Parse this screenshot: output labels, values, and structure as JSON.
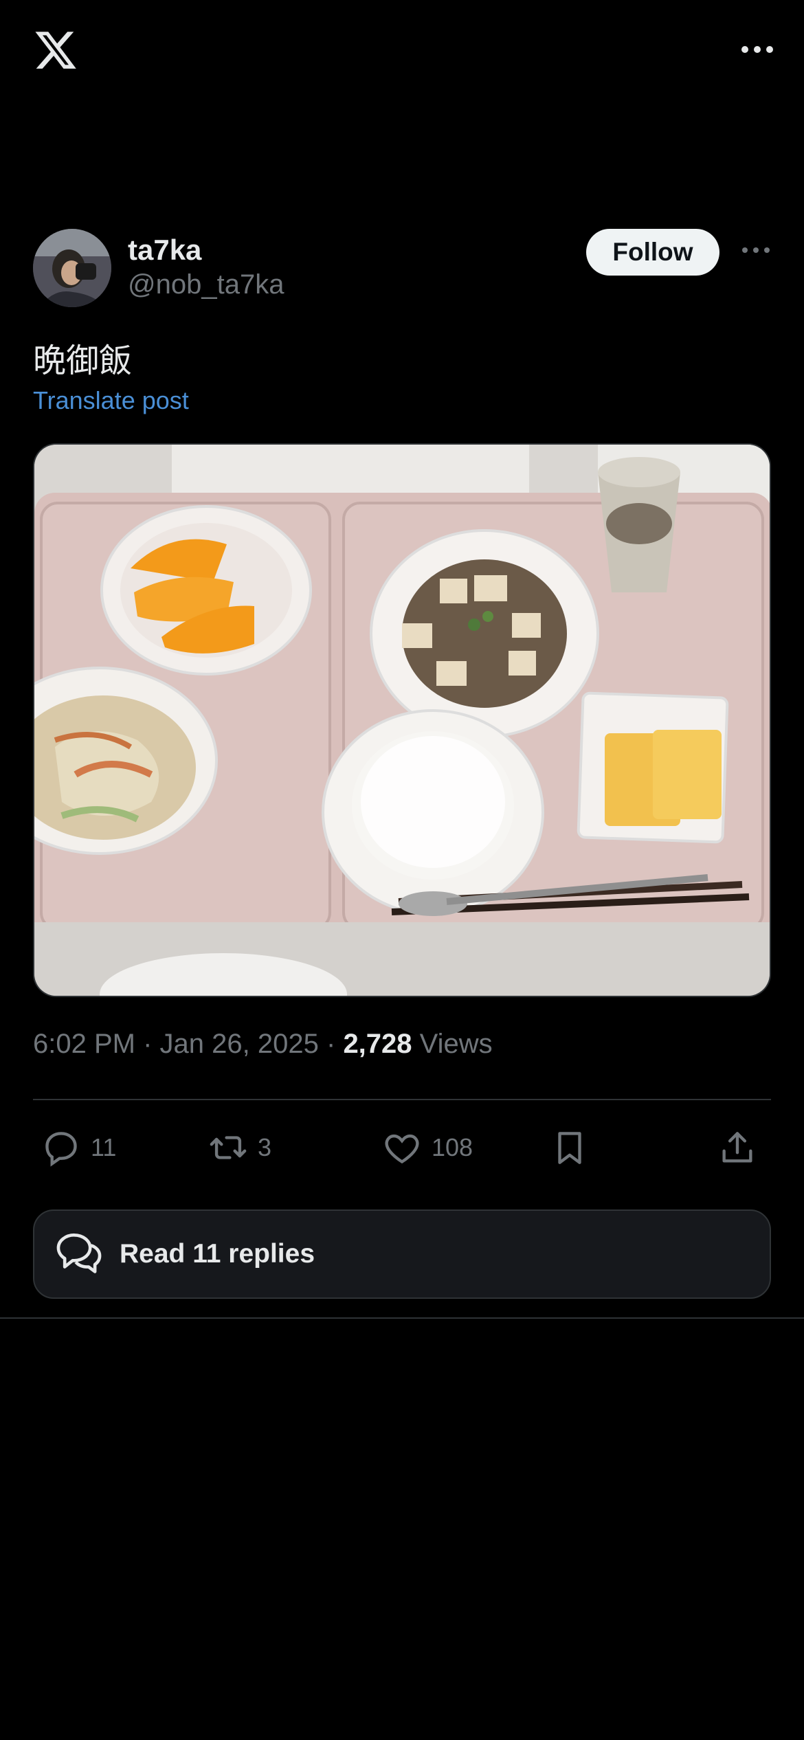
{
  "app": {
    "brand": "X"
  },
  "author": {
    "name": "ta7ka",
    "handle": "@nob_ta7ka",
    "follow_label": "Follow"
  },
  "post": {
    "text": "晩御飯",
    "translate_label": "Translate post",
    "time": "6:02 PM",
    "date": "Jan 26, 2025",
    "separator": "·",
    "views_count": "2,728",
    "views_label": "Views"
  },
  "actions": {
    "replies": "11",
    "reposts": "3",
    "likes": "108"
  },
  "read_replies_label": "Read 11 replies",
  "colors": {
    "background": "#000000",
    "text": "#e7e9ea",
    "muted": "#71767b",
    "link": "#4a8fd6",
    "border": "#2f3336",
    "follow_bg": "#eff3f4"
  },
  "icons": [
    "x-logo-icon",
    "more-icon",
    "reply-icon",
    "repost-icon",
    "like-icon",
    "bookmark-icon",
    "share-icon",
    "chat-bubbles-icon"
  ]
}
